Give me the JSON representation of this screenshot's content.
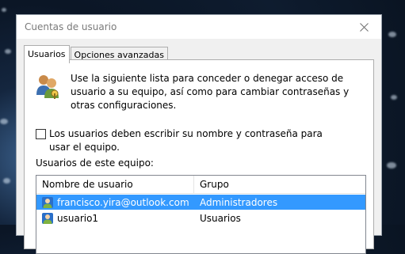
{
  "window": {
    "title": "Cuentas de usuario"
  },
  "tabs": [
    {
      "label": "Usuarios",
      "active": true
    },
    {
      "label": "Opciones avanzadas",
      "active": false
    }
  ],
  "panel": {
    "description": "Use la siguiente lista para conceder o denegar acceso de usuario a su equipo, así como para cambiar contraseñas y otras configuraciones.",
    "require_login_label": "Los usuarios deben escribir su nombre y contraseña para usar el equipo.",
    "require_login_checked": false,
    "users_section_label": "Usuarios de este equipo:"
  },
  "user_list": {
    "columns": [
      "Nombre de usuario",
      "Grupo"
    ],
    "rows": [
      {
        "name": "francisco.yira@outlook.com",
        "group": "Administradores",
        "selected": true
      },
      {
        "name": "usuario1",
        "group": "Usuarios",
        "selected": false
      }
    ]
  },
  "colors": {
    "selection": "#3399ff",
    "window_bg": "#f0f0f0"
  }
}
